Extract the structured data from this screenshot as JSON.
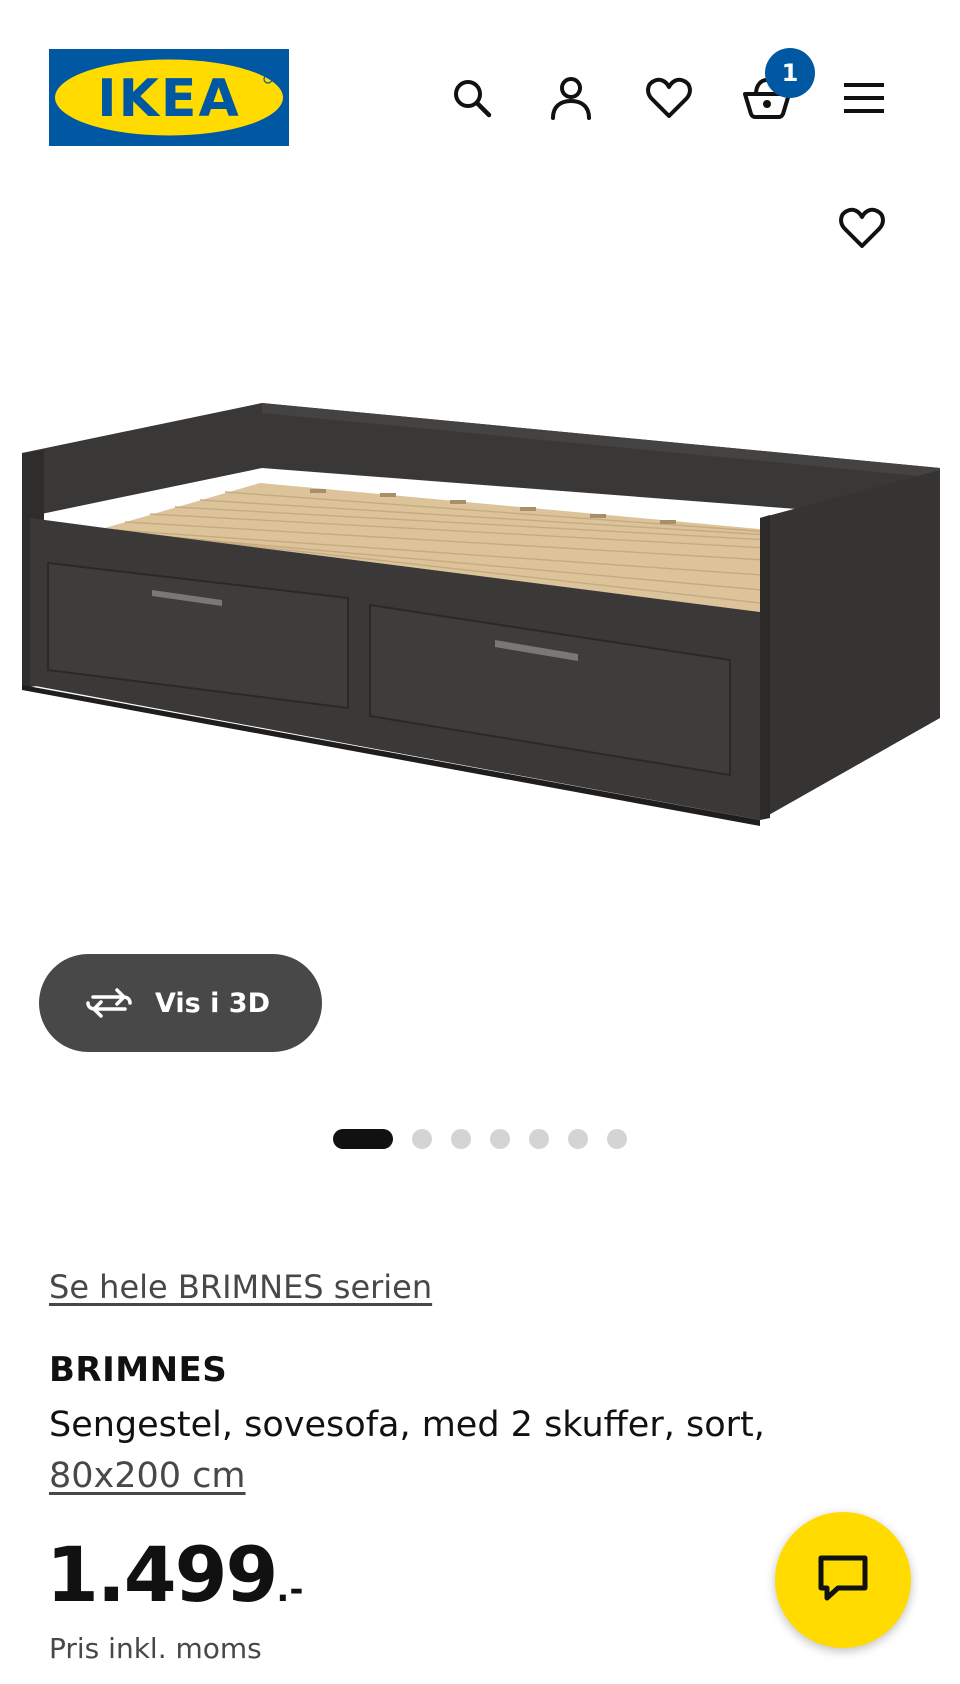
{
  "header": {
    "logo_text": "IKEA",
    "icons": {
      "search": "search-icon",
      "account": "user-icon",
      "favourites": "heart-icon",
      "cart": "basket-icon",
      "menu": "hamburger-menu-icon"
    },
    "cart_count": "1"
  },
  "product_media": {
    "favourite_icon": "heart-icon",
    "view_3d_label": "Vis i 3D",
    "view_3d_icon": "rotate-icon",
    "carousel": {
      "total": 7,
      "active": 1
    }
  },
  "product": {
    "series_link": "Se hele BRIMNES serien",
    "name": "BRIMNES",
    "description": "Sengestel, sovesofa, med 2 skuffer, sort,",
    "size": "80x200 cm",
    "price_amount": "1.499",
    "price_suffix": ".-",
    "price_note": "Pris inkl. moms"
  },
  "chat": {
    "icon": "chat-bubble-icon"
  },
  "colors": {
    "brand_blue": "#0058a3",
    "brand_yellow": "#ffdb00",
    "button_dark": "#484848",
    "text_primary": "#111111",
    "text_secondary": "#484848"
  }
}
